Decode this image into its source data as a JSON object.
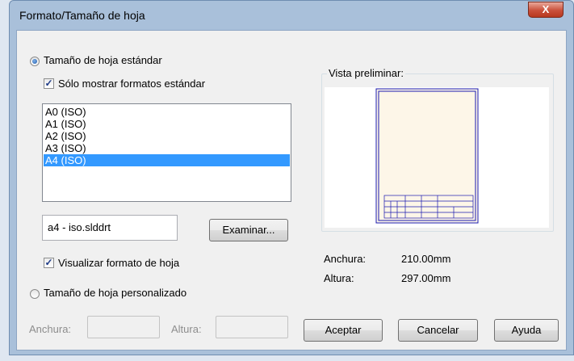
{
  "window": {
    "title": "Formato/Tamaño de hoja",
    "close_label": "X"
  },
  "standard": {
    "radio_label": "Tamaño de hoja estándar",
    "radio_checked": true,
    "only_standard_label": "Sólo mostrar formatos estándar",
    "only_standard_checked": true,
    "formats": [
      "A0 (ISO)",
      "A1 (ISO)",
      "A2 (ISO)",
      "A3 (ISO)",
      "A4 (ISO)"
    ],
    "selected_format": "A4 (ISO)",
    "template_file": "a4 - iso.slddrt",
    "browse_label": "Examinar...",
    "display_format_label": "Visualizar formato de hoja",
    "display_format_checked": true
  },
  "preview": {
    "legend": "Vista preliminar:",
    "width_label": "Anchura:",
    "width_value": "210.00mm",
    "height_label": "Altura:",
    "height_value": "297.00mm"
  },
  "custom": {
    "radio_label": "Tamaño de hoja personalizado",
    "radio_checked": false,
    "width_label": "Anchura:",
    "height_label": "Altura:"
  },
  "buttons": {
    "ok": "Aceptar",
    "cancel": "Cancelar",
    "help": "Ayuda"
  },
  "colors": {
    "selection": "#3399ff",
    "sheet_border": "#1a1ab0",
    "sheet_fill": "#fdf6e8"
  }
}
